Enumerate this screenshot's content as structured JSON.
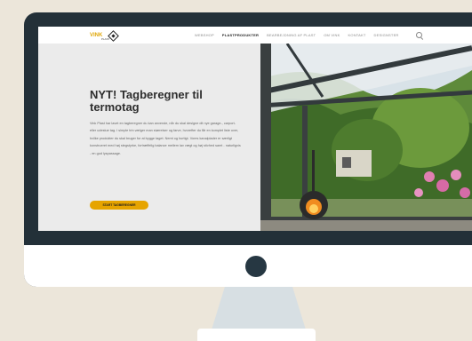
{
  "nav": {
    "logo_text": "VINK",
    "logo_sub": "PLAST",
    "items": [
      {
        "label": "WEBSHOP",
        "active": false
      },
      {
        "label": "PLASTPRODUKTER",
        "active": true
      },
      {
        "label": "BEARBEJDNING AF PLAST",
        "active": false
      },
      {
        "label": "OM VINK",
        "active": false
      },
      {
        "label": "KONTAKT",
        "active": false
      },
      {
        "label": "DESIGNSTER",
        "active": false
      }
    ]
  },
  "hero": {
    "title": "NYT! Tagberegner til termotag",
    "body": "Vink Plast har lavet en tagberegner du kan anvende, når du skal designe dit nye garage-, carport- eller udestue tag. I simple trin vælger man størrelser og farve, hvorefter du får en komplet liste over, hvilke produkter du skal bruger for at bygge taget. Nemt og hurtigt. Vores kanalplader er særligt konstrueret med høj stegstyrke, fortræffelig balance mellem lav vægt og høj stivhed samt - naturligvis - en god lyspassage.",
    "cta_label": "START TAGBEREGNER"
  },
  "colors": {
    "accent": "#e6a400",
    "monitor_frame": "#233038",
    "background": "#ece6da"
  }
}
